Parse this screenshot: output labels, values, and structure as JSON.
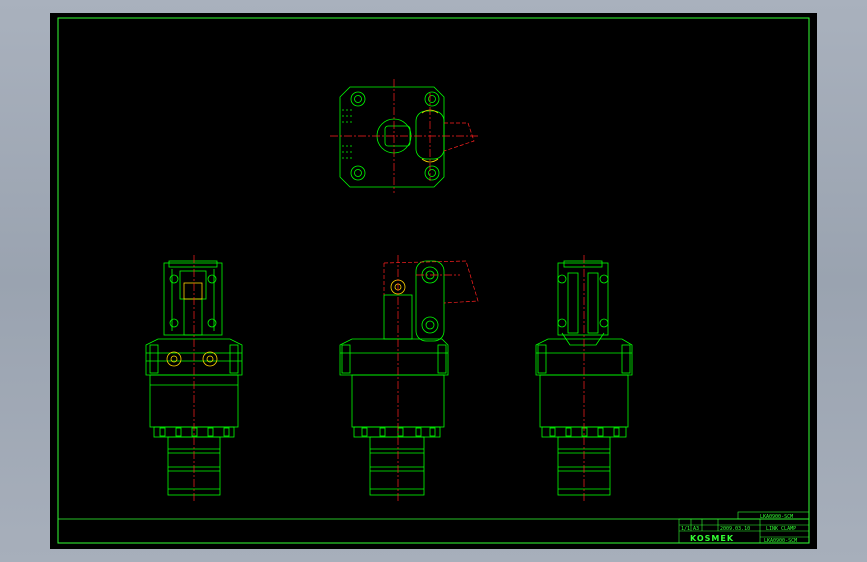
{
  "colors": {
    "background": "#000000",
    "geometry": "#00ff00",
    "centerline": "#ff2020",
    "highlight": "#ffd200",
    "frame": "#33ff33"
  },
  "title_block": {
    "drawing_number_top": "LKA0900-SCM",
    "scale_label": "1/1",
    "size_label": "A3",
    "date": "2009.03.10",
    "product_name": "LINK CLAMP",
    "part_number": "LKA0900-SCM",
    "logo_text": "KOSMEK"
  }
}
